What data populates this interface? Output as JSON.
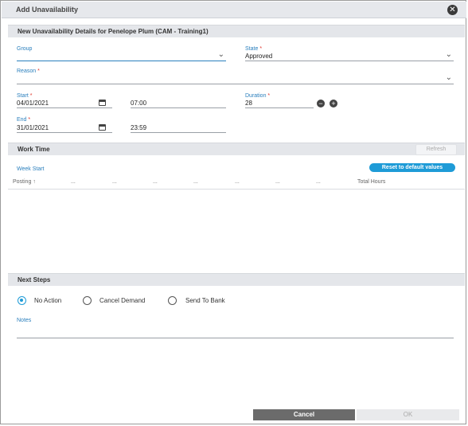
{
  "dialog": {
    "title": "Add Unavailability",
    "close_icon": "close-icon"
  },
  "details": {
    "section_title": "New Unavailability Details for Penelope Plum (CAM - Training1)",
    "group": {
      "label": "Group",
      "value": ""
    },
    "state": {
      "label": "State",
      "required": "*",
      "value": "Approved"
    },
    "reason": {
      "label": "Reason",
      "required": "*",
      "value": ""
    },
    "start": {
      "label": "Start",
      "required": "*",
      "date": "04/01/2021",
      "time": "07:00"
    },
    "duration": {
      "label": "Duration",
      "required": "*",
      "value": "28"
    },
    "end": {
      "label": "End",
      "required": "*",
      "date": "31/01/2021",
      "time": "23:59"
    }
  },
  "work_time": {
    "section_title": "Work Time",
    "refresh_label": "Refresh",
    "week_start_label": "Week Start",
    "reset_label": "Reset to default values",
    "columns": [
      "Posting",
      "...",
      "...",
      "...",
      "...",
      "...",
      "...",
      "...",
      "Total Hours"
    ]
  },
  "next_steps": {
    "section_title": "Next Steps",
    "options": [
      "No Action",
      "Cancel Demand",
      "Send To Bank"
    ],
    "selected": "No Action",
    "notes_label": "Notes"
  },
  "footer": {
    "cancel_label": "Cancel",
    "ok_label": "OK"
  },
  "colors": {
    "accent": "#1e9bd7",
    "label": "#2a7fbd",
    "required": "#e0352b",
    "cancel_bg": "#6b6b6b"
  }
}
